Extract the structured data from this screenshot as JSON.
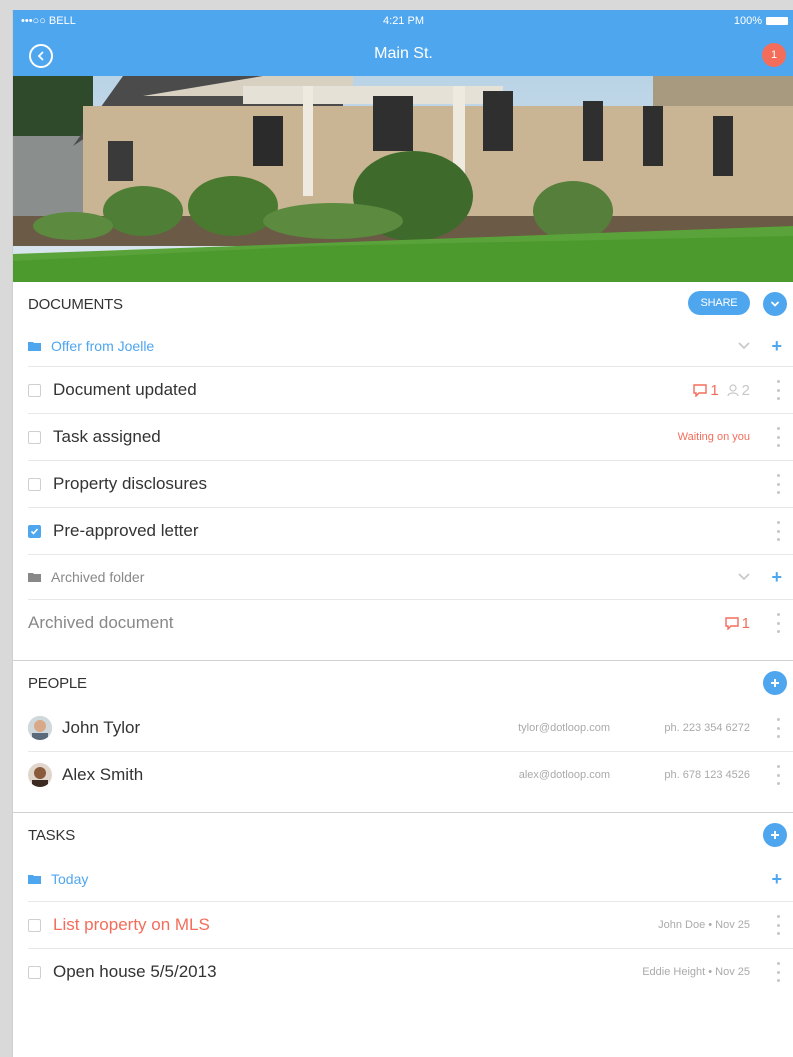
{
  "status": {
    "carrier": "•••○○ BELL",
    "time": "4:21 PM",
    "battery": "100%"
  },
  "nav": {
    "title": "Main St.",
    "notif_count": "1"
  },
  "documents": {
    "title": "DOCUMENTS",
    "share": "SHARE",
    "folder": "Offer from Joelle",
    "items": [
      {
        "label": "Document updated",
        "comments": "1",
        "people": "2"
      },
      {
        "label": "Task assigned",
        "status": "Waiting on you"
      },
      {
        "label": "Property disclosures"
      },
      {
        "label": "Pre-approved letter",
        "checked": true
      }
    ],
    "archived_folder": "Archived folder",
    "archived_doc": {
      "label": "Archived document",
      "comments": "1"
    }
  },
  "people": {
    "title": "PEOPLE",
    "items": [
      {
        "name": "John Tylor",
        "email": "tylor@dotloop.com",
        "phone": "ph. 223 354 6272"
      },
      {
        "name": "Alex Smith",
        "email": "alex@dotloop.com",
        "phone": "ph. 678 123 4526"
      }
    ]
  },
  "tasks": {
    "title": "TASKS",
    "folder": "Today",
    "items": [
      {
        "label": "List property on MLS",
        "meta": "John Doe • Nov 25"
      },
      {
        "label": "Open house 5/5/2013",
        "meta": "Eddie Height • Nov 25"
      }
    ]
  },
  "colors": {
    "accent": "#4ea6ef",
    "alert": "#f36d5a"
  }
}
